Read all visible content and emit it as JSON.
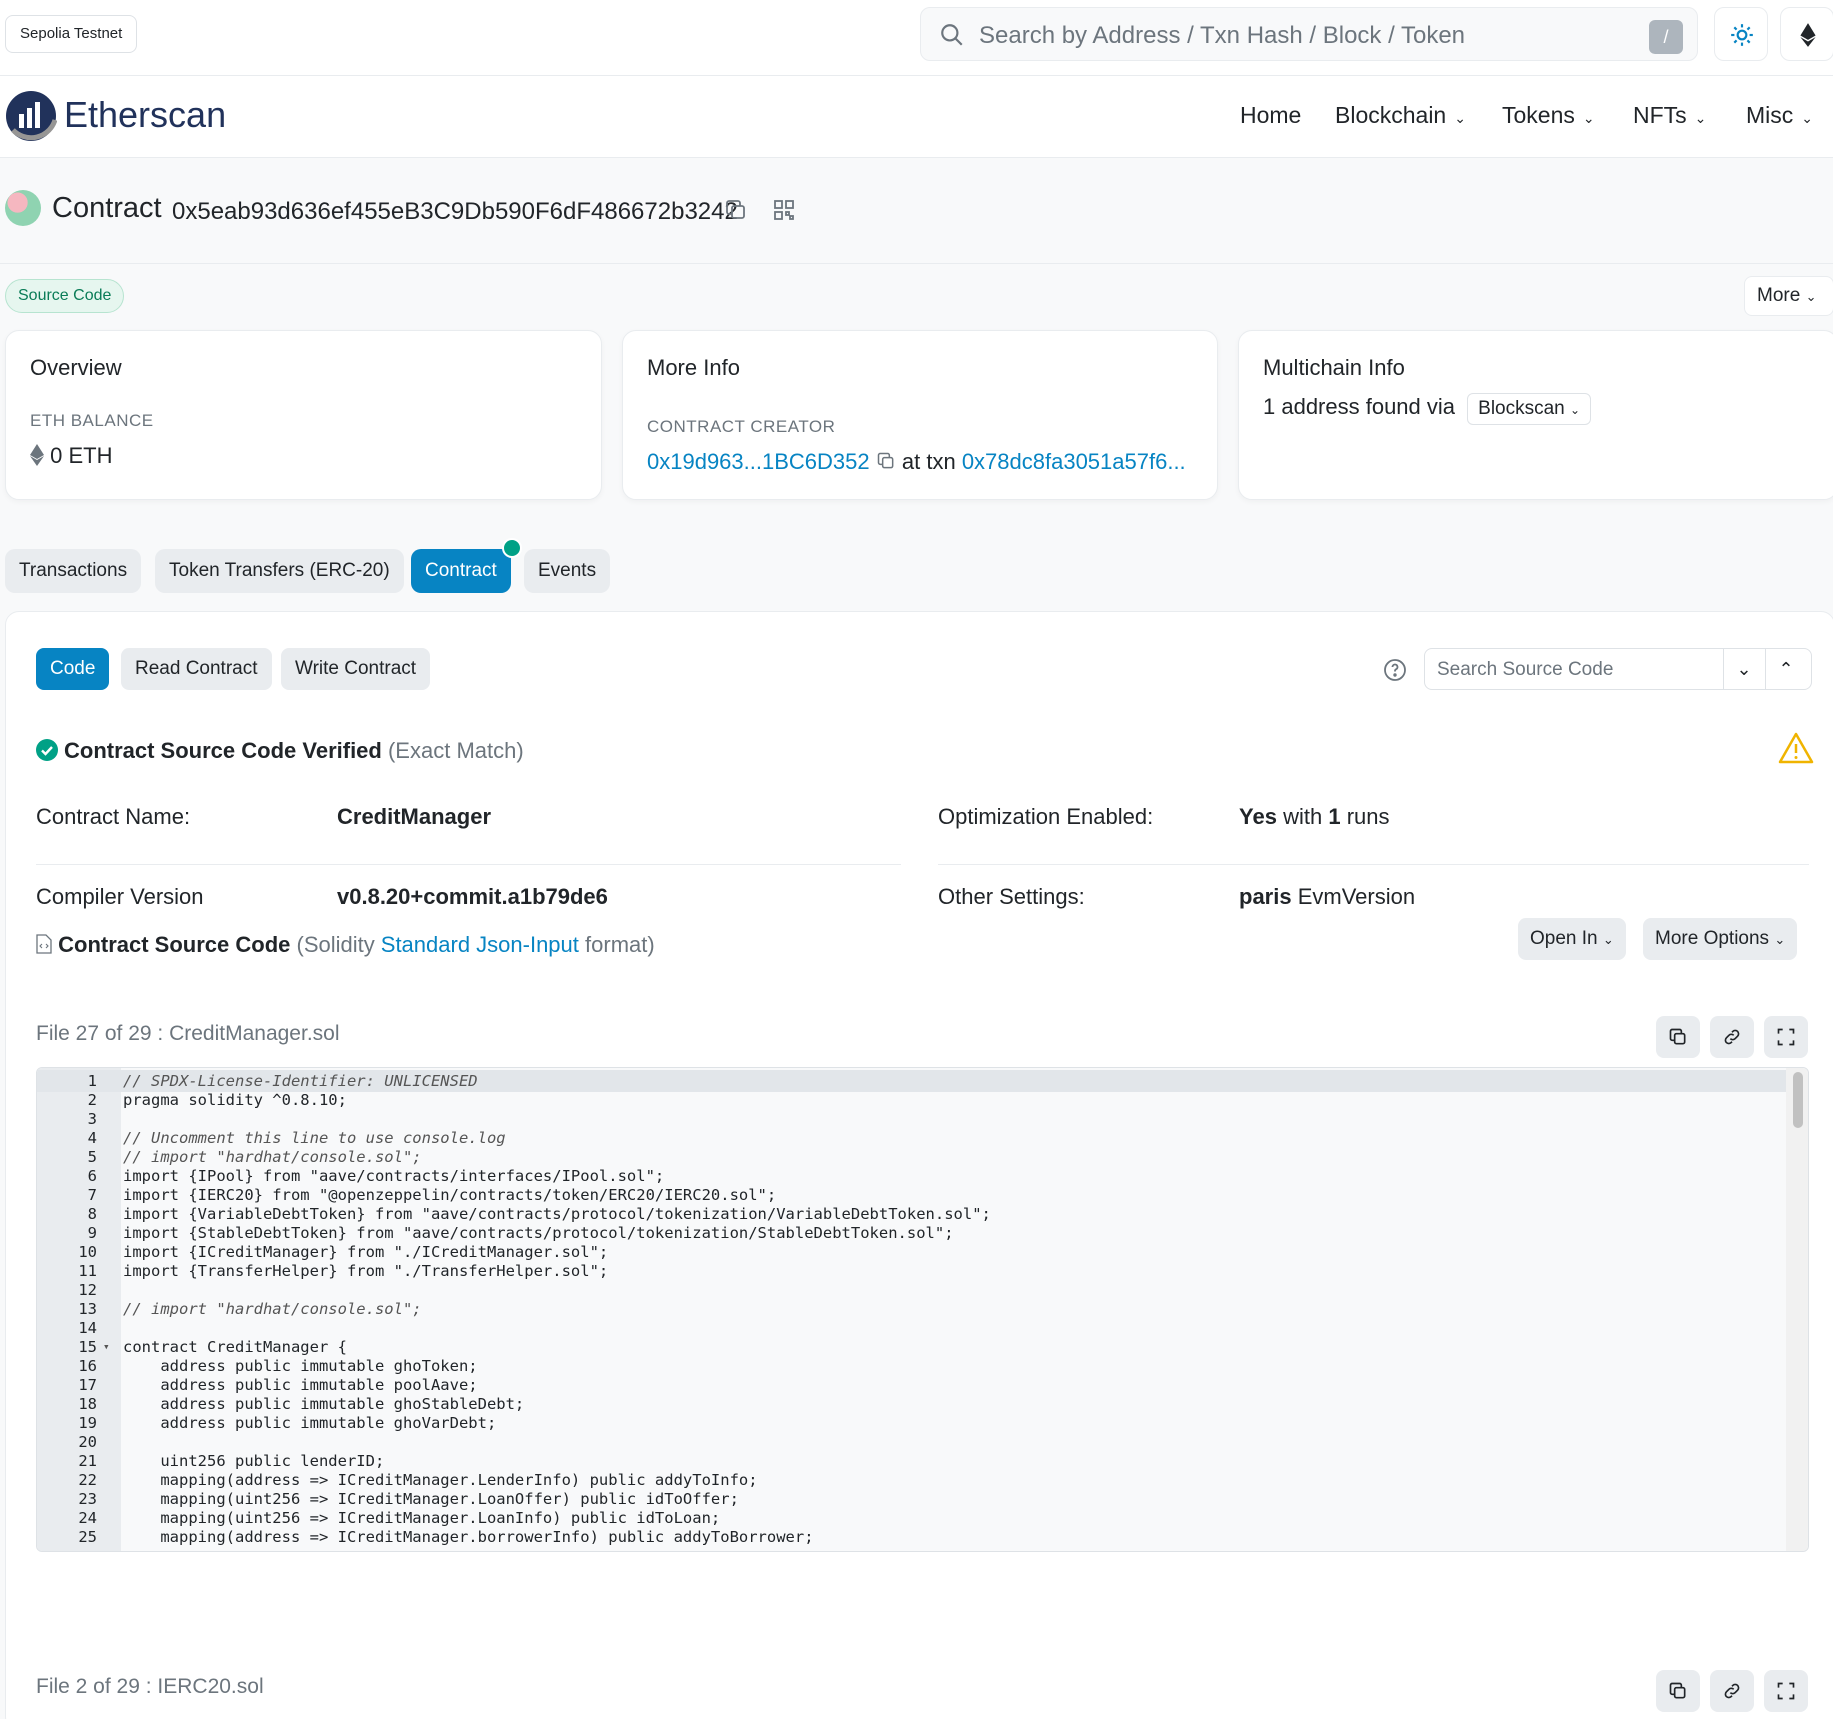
{
  "topbar": {
    "network": "Sepolia Testnet",
    "search_placeholder": "Search by Address / Txn Hash / Block / Token",
    "search_shortcut": "/"
  },
  "nav": {
    "brand": "Etherscan",
    "items": [
      "Home",
      "Blockchain",
      "Tokens",
      "NFTs",
      "Misc"
    ]
  },
  "contract": {
    "label": "Contract",
    "address": "0x5eab93d636ef455eB3C9Db590F6dF486672b3242",
    "badge": "Source Code",
    "more": "More"
  },
  "overview": {
    "title": "Overview",
    "balance_label": "ETH BALANCE",
    "balance_value": "0 ETH"
  },
  "more_info": {
    "title": "More Info",
    "creator_label": "CONTRACT CREATOR",
    "creator_addr": "0x19d963...1BC6D352",
    "at_txn": "at txn",
    "txn_hash": "0x78dc8fa3051a57f6..."
  },
  "multichain": {
    "title": "Multichain Info",
    "text": "1 address found via",
    "selector": "Blockscan"
  },
  "tabs": [
    "Transactions",
    "Token Transfers (ERC-20)",
    "Contract",
    "Events"
  ],
  "subtabs": [
    "Code",
    "Read Contract",
    "Write Contract"
  ],
  "source_search_placeholder": "Search Source Code",
  "verified": {
    "text": "Contract Source Code Verified",
    "match": "(Exact Match)"
  },
  "details": {
    "name_label": "Contract Name:",
    "name_value": "CreditManager",
    "opt_label": "Optimization Enabled:",
    "opt_yes": "Yes",
    "opt_with": "with",
    "opt_runs_count": "1",
    "opt_runs": "runs",
    "compiler_label": "Compiler Version",
    "compiler_value": "v0.8.20+commit.a1b79de6",
    "other_label": "Other Settings:",
    "other_bold": "paris",
    "other_rest": "EvmVersion"
  },
  "source": {
    "title": "Contract Source Code",
    "format_pre": "(Solidity",
    "format_link": "Standard Json-Input",
    "format_post": "format)",
    "open_in": "Open In",
    "more_options": "More Options",
    "file1": "File 27 of 29 : CreditManager.sol",
    "file2": "File 2 of 29 : IERC20.sol"
  },
  "code_lines": [
    "// SPDX-License-Identifier: UNLICENSED",
    "pragma solidity ^0.8.10;",
    "",
    "// Uncomment this line to use console.log",
    "// import \"hardhat/console.sol\";",
    "import {IPool} from \"aave/contracts/interfaces/IPool.sol\";",
    "import {IERC20} from \"@openzeppelin/contracts/token/ERC20/IERC20.sol\";",
    "import {VariableDebtToken} from \"aave/contracts/protocol/tokenization/VariableDebtToken.sol\";",
    "import {StableDebtToken} from \"aave/contracts/protocol/tokenization/StableDebtToken.sol\";",
    "import {ICreditManager} from \"./ICreditManager.sol\";",
    "import {TransferHelper} from \"./TransferHelper.sol\";",
    "",
    "// import \"hardhat/console.sol\";",
    "",
    "contract CreditManager {",
    "    address public immutable ghoToken;",
    "    address public immutable poolAave;",
    "    address public immutable ghoStableDebt;",
    "    address public immutable ghoVarDebt;",
    "",
    "    uint256 public lenderID;",
    "    mapping(address => ICreditManager.LenderInfo) public addyToInfo;",
    "    mapping(uint256 => ICreditManager.LoanOffer) public idToOffer;",
    "    mapping(uint256 => ICreditManager.LoanInfo) public idToLoan;",
    "    mapping(address => ICreditManager.borrowerInfo) public addyToBorrower;"
  ]
}
